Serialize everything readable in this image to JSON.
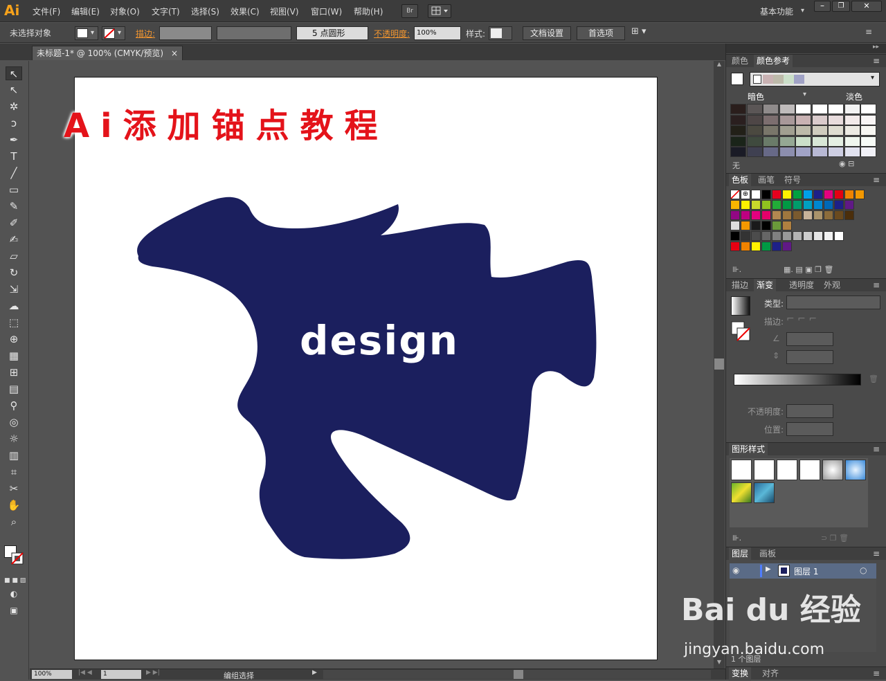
{
  "app": {
    "logo": "Ai"
  },
  "menu": [
    "文件(F)",
    "编辑(E)",
    "对象(O)",
    "文字(T)",
    "选择(S)",
    "效果(C)",
    "视图(V)",
    "窗口(W)",
    "帮助(H)"
  ],
  "menu_right": {
    "br": "Br",
    "workspace": "基本功能"
  },
  "control": {
    "selection": "未选择对象",
    "stroke_label": "描边:",
    "brush": "5 点圆形",
    "opacity_label": "不透明度:",
    "opacity_value": "100%",
    "style_label": "样式:",
    "doc_setup": "文档设置",
    "prefs": "首选项"
  },
  "document": {
    "tab_title": "未标题-1* @ 100% (CMYK/预览)",
    "close": "×"
  },
  "artwork": {
    "heading": "Ai添加锚点教程",
    "text": "design",
    "fill_color": "#1b1f5e",
    "heading_color": "#e4131a"
  },
  "status": {
    "zoom": "100%",
    "artboard": "1",
    "mode": "编组选择"
  },
  "panels": {
    "color_tabs": [
      "颜色",
      "颜色参考"
    ],
    "dark_label": "暗色",
    "light_label": "淡色",
    "none_label": "无",
    "swatch_tabs": [
      "色板",
      "画笔",
      "符号"
    ],
    "gradient_tabs": [
      "描边",
      "渐变",
      "透明度",
      "外观"
    ],
    "type_label": "类型:",
    "stroke_label": "描边:",
    "opacity_label": "不透明度:",
    "position_label": "位置:",
    "graphic_styles": "图形样式",
    "layer_tabs": [
      "图层",
      "画板"
    ],
    "layer_name": "图层 1",
    "layer_count": "1 个图层",
    "bottom_tabs": [
      "变换",
      "对齐"
    ]
  },
  "watermark": {
    "brand": "Bai du 经验",
    "url": "jingyan.baidu.com"
  }
}
